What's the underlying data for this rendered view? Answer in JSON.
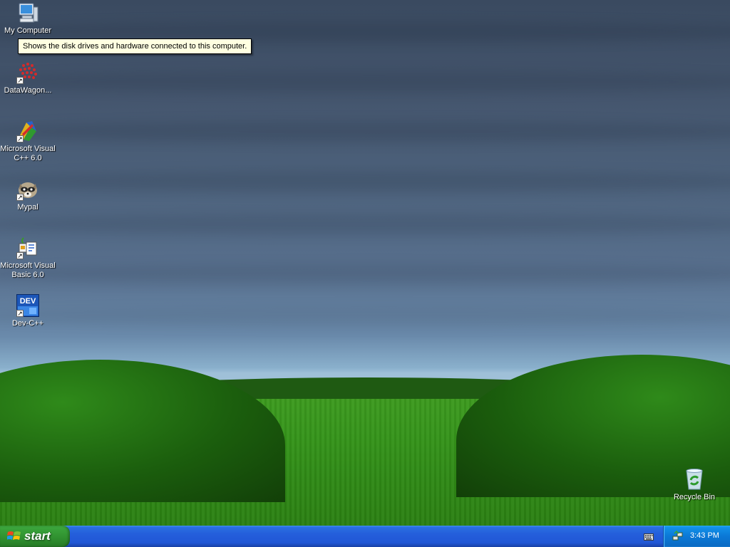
{
  "desktop": {
    "icons": [
      {
        "label": "My Computer",
        "icon": "computer-icon"
      },
      {
        "label": "DataWagon...",
        "icon": "datawagon-icon"
      },
      {
        "label": "Microsoft Visual C++ 6.0",
        "icon": "visual-cpp-icon"
      },
      {
        "label": "Mypal",
        "icon": "mypal-icon"
      },
      {
        "label": "Microsoft Visual Basic 6.0",
        "icon": "visual-basic-icon"
      },
      {
        "label": "Dev-C++",
        "icon": "dev-cpp-icon",
        "badge": "DEV"
      },
      {
        "label": "Recycle Bin",
        "icon": "recycle-bin-icon"
      }
    ],
    "tooltip": "Shows the disk drives and hardware connected to this computer."
  },
  "taskbar": {
    "start_label": "start",
    "clock": "3:43 PM"
  },
  "colors": {
    "taskbar_blue": "#245edb",
    "start_green": "#2f8f2f",
    "tray_blue": "#0b78d6",
    "tooltip_bg": "#ffffe1"
  }
}
